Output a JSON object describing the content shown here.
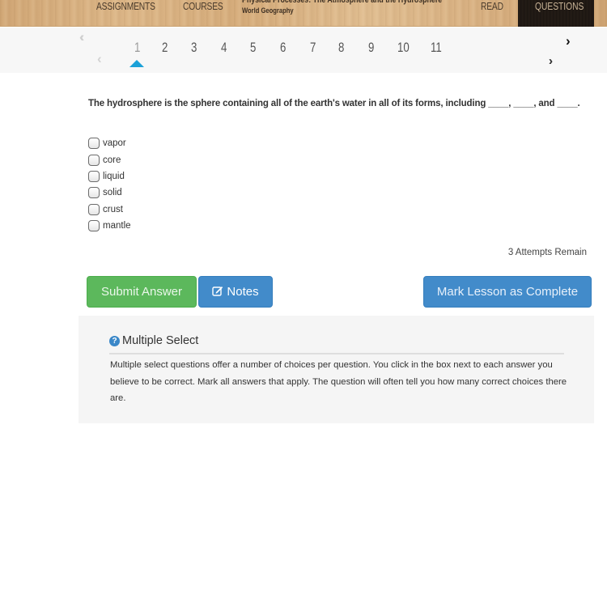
{
  "topnav": {
    "links": {
      "assignments": "ASSIGNMENTS",
      "courses": "COURSES",
      "read": "READ",
      "questions": "QUESTIONS"
    },
    "lesson_title": "Physical Processes: The Atmosphere and the Hydrosphere",
    "course_name": "World Geography",
    "active_tab": "QUESTIONS"
  },
  "pager": {
    "first_icon": "double-chevron-left-icon",
    "prev_icon": "chevron-left-icon",
    "next_icon": "chevron-right-icon",
    "last_icon": "double-chevron-right-icon",
    "pages": [
      "1",
      "2",
      "3",
      "4",
      "5",
      "6",
      "7",
      "8",
      "9",
      "10",
      "11"
    ],
    "current_page": "1",
    "marker_color": "#1ba1d8"
  },
  "question": {
    "text": "The hydrosphere is the sphere containing all of the earth's water in all of its forms, including ____, ____, and ____.",
    "options": [
      {
        "label": "vapor",
        "checked": false
      },
      {
        "label": "core",
        "checked": false
      },
      {
        "label": "liquid",
        "checked": false
      },
      {
        "label": "solid",
        "checked": false
      },
      {
        "label": "crust",
        "checked": false
      },
      {
        "label": "mantle",
        "checked": false
      }
    ],
    "attempts": "3 Attempts Remain"
  },
  "actions": {
    "submit_label": "Submit Answer",
    "notes_label": "Notes",
    "notes_icon": "edit-icon",
    "complete_label": "Mark Lesson as Complete",
    "colors": {
      "submit": "#5cb85c",
      "primary": "#428bca"
    }
  },
  "help": {
    "icon": "question-circle-icon",
    "title": "Multiple Select",
    "body": "Multiple select questions offer a number of choices per question. You click in the box next to each answer you believe to be correct. Mark all answers that apply. The question will often tell you how many correct choices there are."
  }
}
